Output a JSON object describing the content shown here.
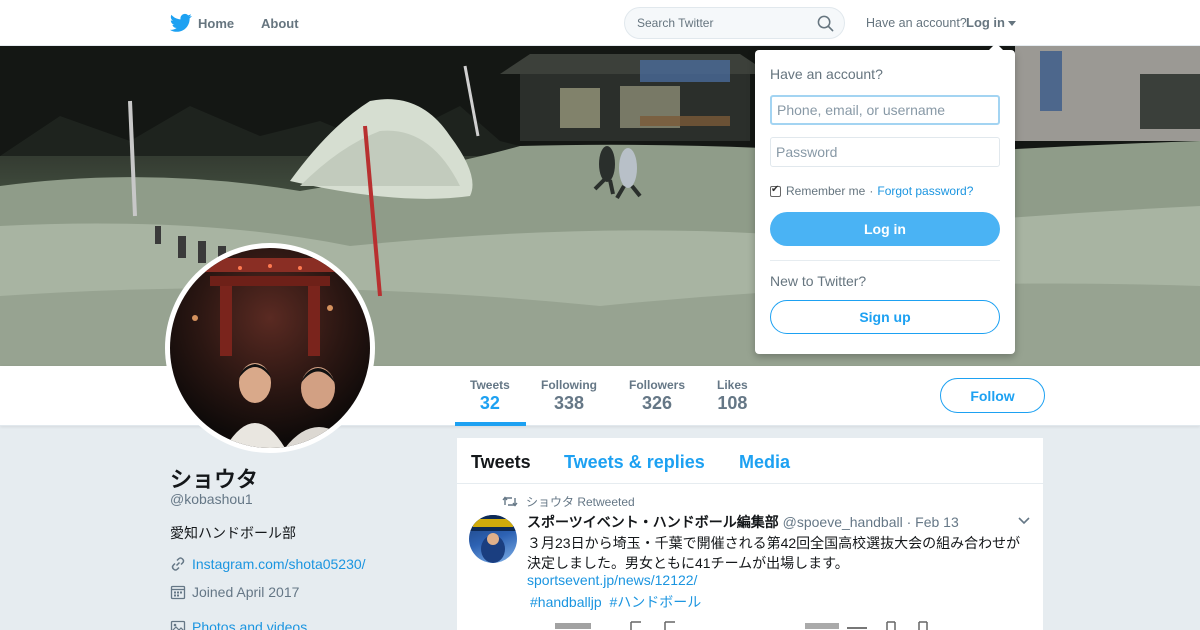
{
  "nav": {
    "home_label": "Home",
    "about_label": "About",
    "search_placeholder": "Search Twitter",
    "have_account_text": "Have an account?",
    "login_label": "Log in"
  },
  "profile": {
    "name": "ショウタ",
    "handle": "@kobashou1",
    "bio": "愛知ハンドボール部",
    "website": "Instagram.com/shota05230/",
    "joined": "Joined April 2017",
    "photos_link": "Photos and videos"
  },
  "stats": [
    {
      "label": "Tweets",
      "value": "32"
    },
    {
      "label": "Following",
      "value": "338"
    },
    {
      "label": "Followers",
      "value": "326"
    },
    {
      "label": "Likes",
      "value": "108"
    }
  ],
  "follow_label": "Follow",
  "timeline": {
    "tabs": [
      "Tweets",
      "Tweets & replies",
      "Media"
    ],
    "tweet": {
      "retweeted_by": "ショウタ Retweeted",
      "author_name": "スポーツイベント・ハンドボール編集部",
      "author_handle": "@spoeve_handball",
      "date": "· Feb 13",
      "text": "３月23日から埼玉・千葉で開催される第42回全国高校選抜大会の組み合わせが決定しました。男女ともに41チームが出場します。",
      "url": "sportsevent.jp/news/12122/",
      "hashtags": [
        "#handballjp",
        "#ハンドボール"
      ]
    }
  },
  "login_dropdown": {
    "title": "Have an account?",
    "username_placeholder": "Phone, email, or username",
    "password_placeholder": "Password",
    "remember_me": "Remember me",
    "separator": "·",
    "forgot_password": "Forgot password?",
    "login_button": "Log in",
    "new_to_twitter": "New to Twitter?",
    "signup_button": "Sign up"
  },
  "colors": {
    "accent": "#1da1f2",
    "link": "#1b95e0",
    "login_button_bg": "#4ab3f4",
    "text_muted": "#657786"
  }
}
